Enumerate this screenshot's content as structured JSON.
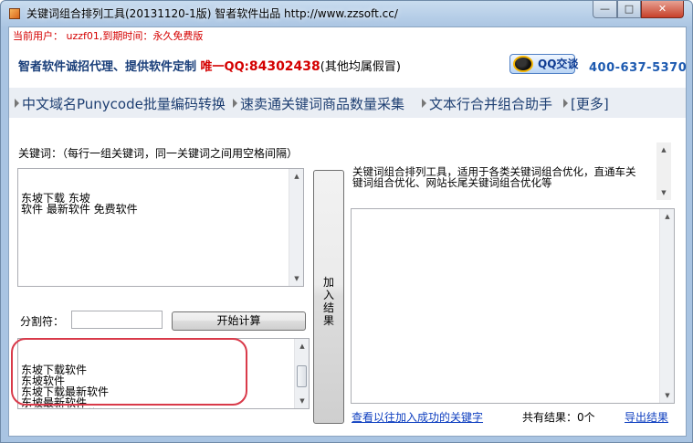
{
  "window": {
    "title": "关键词组合排列工具(20131120-1版) 智者软件出品 http://www.zzsoft.cc/",
    "minimize": "—",
    "maximize": "□",
    "close": "✕"
  },
  "header": {
    "current_user": "当前用户：  uzzf01,到期时间：永久免费版",
    "promo_main": "智者软件诚招代理、提供软件定制 ",
    "promo_qq_label": "唯一QQ:",
    "promo_qq": "84302438",
    "promo_rest": "(其他均属假冒)",
    "qq_button": "QQ交谈",
    "phone": "400-637-5370"
  },
  "nav": {
    "items": [
      {
        "label": "中文域名Punycode批量编码转换"
      },
      {
        "label": "速卖通关键词商品数量采集"
      },
      {
        "label": "文本行合并组合助手"
      },
      {
        "label": "[更多]"
      }
    ]
  },
  "left": {
    "keyword_label": "关键词：（每行一组关键词，同一关键词之间用空格间隔）",
    "keywords_text": "东坡下载 东坡\n软件 最新软件 免费软件",
    "separator_label": "分割符：",
    "separator_value": "",
    "calc_button": "开始计算",
    "results_text": "东坡下载软件\n东坡软件\n东坡下载最新软件\n东坡最新软件\n东坡下载免费软件\n东坡免费软件"
  },
  "middle": {
    "add_button": "加\n入\n结\n果"
  },
  "right": {
    "description": "关键词组合排列工具，适用于各类关键词组合优化，直通车关\n键词组合优化、网站长尾关键词组合优化等",
    "result_text": "",
    "history_link": "查看以往加入成功的关键字",
    "total_label": "共有结果：0个",
    "export_link": "导出结果"
  },
  "colors": {
    "accent_red": "#d40000",
    "promo_blue": "#1a3f7a",
    "link_blue": "#1040c0",
    "highlight_oval": "#d93a4a"
  },
  "icons": {
    "app": "app-icon",
    "qq": "qq-penguin-icon",
    "nav_bullet": "triangle-right-icon"
  }
}
